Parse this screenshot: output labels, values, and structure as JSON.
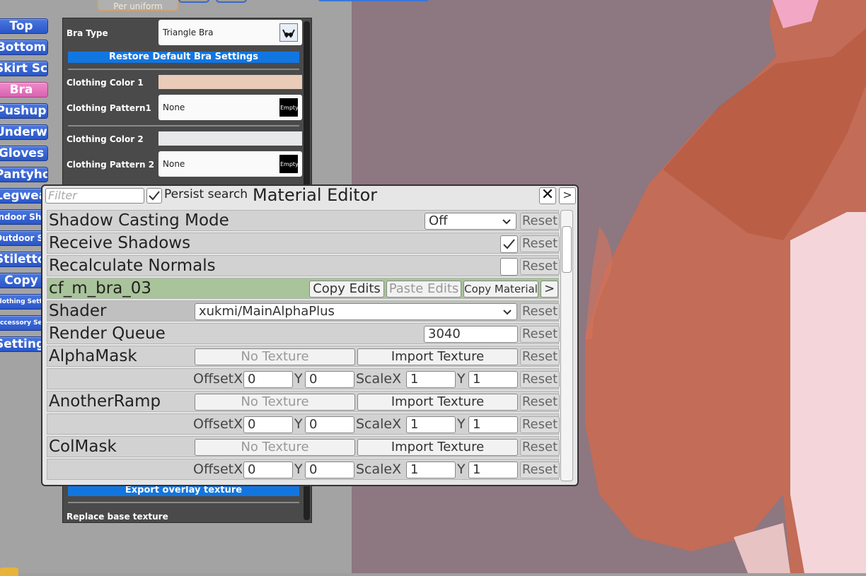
{
  "header": {
    "per_uniform": "Per uniform"
  },
  "sidebar": {
    "items": [
      {
        "label": "Top",
        "style": "",
        "active": false
      },
      {
        "label": "Bottom",
        "style": "",
        "active": false
      },
      {
        "label": "Skirt Scale",
        "style": "",
        "active": false
      },
      {
        "label": "Bra",
        "style": "",
        "active": true
      },
      {
        "label": "Pushup",
        "style": "",
        "active": false
      },
      {
        "label": "Underwear",
        "style": "",
        "active": false
      },
      {
        "label": "Gloves",
        "style": "",
        "active": false
      },
      {
        "label": "Pantyhose",
        "style": "",
        "active": false
      },
      {
        "label": "Legwear",
        "style": "",
        "active": false
      },
      {
        "label": "Indoor Shoes",
        "style": "small",
        "active": false
      },
      {
        "label": "Outdoor Shoes",
        "style": "small",
        "active": false
      },
      {
        "label": "Stilettos",
        "style": "",
        "active": false
      },
      {
        "label": "Copy",
        "style": "",
        "active": false
      },
      {
        "label": "Clothing Settings",
        "style": "tiny",
        "active": false
      },
      {
        "label": "Accessory Settings",
        "style": "tiny",
        "active": false
      },
      {
        "label": "Settings",
        "style": "",
        "active": false
      }
    ]
  },
  "bra_panel": {
    "bra_type_label": "Bra Type",
    "bra_type_value": "Triangle Bra",
    "restore_button": "Restore Default Bra Settings",
    "color1_label": "Clothing Color 1",
    "pattern1_label": "Clothing Pattern1",
    "pattern1_value": "None",
    "pattern1_thumb": "Empty",
    "color2_label": "Clothing Color 2",
    "pattern2_label": "Clothing Pattern 2",
    "pattern2_value": "None",
    "pattern2_thumb": "Empty",
    "export_button": "Export overlay texture",
    "replace_label": "Replace base texture",
    "colors": {
      "color1": "#e9cbb8",
      "color2": "#e6e8ea"
    }
  },
  "material_editor": {
    "filter_placeholder": "Filter",
    "persist_search_label": "Persist search",
    "persist_search_checked": true,
    "title": "Material Editor",
    "close_glyph": "✕",
    "expand_glyph": ">",
    "reset_label": "Reset",
    "rows": {
      "shadow_casting": {
        "label": "Shadow Casting Mode",
        "value": "Off"
      },
      "receive_shadows": {
        "label": "Receive Shadows",
        "checked": true
      },
      "recalc_normals": {
        "label": "Recalculate Normals",
        "checked": false
      },
      "material": {
        "name": "cf_m_bra_03",
        "copy_edits": "Copy Edits",
        "paste_edits": "Paste Edits",
        "copy_material": "Copy Material",
        "more": ">"
      },
      "shader": {
        "label": "Shader",
        "value": "xukmi/MainAlphaPlus"
      },
      "render_queue": {
        "label": "Render Queue",
        "value": "3040"
      },
      "textures": [
        {
          "label": "AlphaMask",
          "no_texture": "No Texture",
          "import": "Import Texture",
          "offset_label": "OffsetX",
          "offset_x": "0",
          "y_label": "Y",
          "offset_y": "0",
          "scale_label": "ScaleX",
          "scale_x": "1",
          "scale_y_label": "Y",
          "scale_y": "1"
        },
        {
          "label": "AnotherRamp",
          "no_texture": "No Texture",
          "import": "Import Texture",
          "offset_label": "OffsetX",
          "offset_x": "0",
          "y_label": "Y",
          "offset_y": "0",
          "scale_label": "ScaleX",
          "scale_x": "1",
          "scale_y_label": "Y",
          "scale_y": "1"
        },
        {
          "label": "ColMask",
          "no_texture": "No Texture",
          "import": "Import Texture",
          "offset_label": "OffsetX",
          "offset_x": "0",
          "y_label": "Y",
          "offset_y": "0",
          "scale_label": "ScaleX",
          "scale_x": "1",
          "scale_y_label": "Y",
          "scale_y": "1"
        }
      ]
    }
  }
}
